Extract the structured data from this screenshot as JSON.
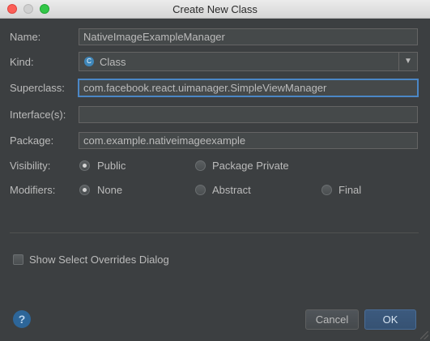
{
  "window": {
    "title": "Create New Class"
  },
  "form": {
    "name_label": "Name:",
    "name_value": "NativeImageExampleManager",
    "kind_label": "Kind:",
    "kind_value": "Class",
    "kind_icon": "class-icon",
    "kind_icon_letter": "C",
    "superclass_label": "Superclass:",
    "superclass_value": "com.facebook.react.uimanager.SimpleViewManager",
    "interfaces_label": "Interface(s):",
    "interfaces_value": "",
    "package_label": "Package:",
    "package_value": "com.example.nativeimageexample"
  },
  "visibility": {
    "label": "Visibility:",
    "options": [
      {
        "label": "Public",
        "selected": true
      },
      {
        "label": "Package Private",
        "selected": false
      }
    ]
  },
  "modifiers": {
    "label": "Modifiers:",
    "options": [
      {
        "label": "None",
        "selected": true
      },
      {
        "label": "Abstract",
        "selected": false
      },
      {
        "label": "Final",
        "selected": false
      }
    ]
  },
  "overrides": {
    "label": "Show Select Overrides Dialog",
    "checked": false
  },
  "buttons": {
    "help": "?",
    "cancel": "Cancel",
    "ok": "OK"
  },
  "colors": {
    "accent": "#4b87c6",
    "background": "#3c3f41",
    "primary_button": "#365273"
  }
}
